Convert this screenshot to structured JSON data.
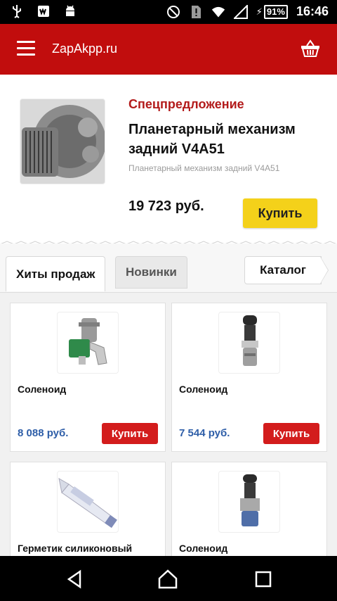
{
  "status_bar": {
    "left_icons": [
      "usb-icon",
      "photo-icon",
      "android-icon"
    ],
    "right_icons": [
      "do-not-disturb-icon",
      "sim-alert-icon",
      "wifi-icon",
      "signal-icon"
    ],
    "battery": "91%",
    "time": "16:46"
  },
  "app_bar": {
    "title": "ZapAkpp.ru",
    "menu_icon": "menu-icon",
    "cart_icon": "basket-icon"
  },
  "promo": {
    "label": "Спецпредложение",
    "title": "Планетарный механизм задний V4A51",
    "subtitle": "Планетарный механизм задний V4A51",
    "price": "19 723 руб.",
    "buy_label": "Купить"
  },
  "tabs": {
    "hits": "Хиты продаж",
    "new": "Новинки",
    "catalog": "Каталог"
  },
  "products": [
    {
      "name": "Соленоид",
      "price": "8 088 руб.",
      "buy_label": "Купить"
    },
    {
      "name": "Соленоид",
      "price": "7 544 руб.",
      "buy_label": "Купить"
    },
    {
      "name": "Герметик силиконовый",
      "price": "",
      "buy_label": ""
    },
    {
      "name": "Соленоид",
      "price": "",
      "buy_label": ""
    }
  ],
  "colors": {
    "app_bar": "#c10d0d",
    "promo_label": "#b31b1b",
    "buy_yellow": "#f4d11a",
    "buy_red": "#d31c1c",
    "price_blue": "#2e5ea8"
  }
}
